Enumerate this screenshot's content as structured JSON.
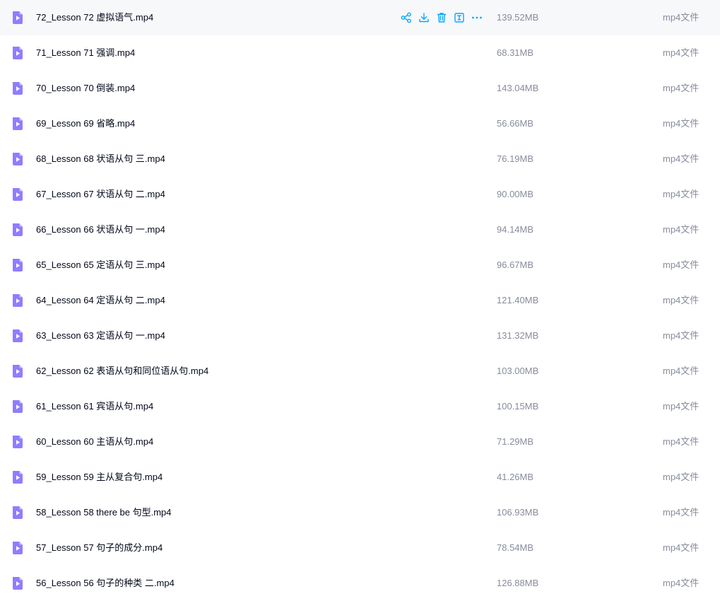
{
  "colors": {
    "accent": "#06a7ff",
    "icon_purple": "#8f7dff",
    "hover_row_bg": "#f7f8fa",
    "name_text": "#03081a",
    "meta_text": "#878c9c"
  },
  "row_actions": [
    {
      "name": "share-icon"
    },
    {
      "name": "download-icon"
    },
    {
      "name": "delete-icon"
    },
    {
      "name": "rename-icon"
    },
    {
      "name": "more-icon"
    }
  ],
  "files": [
    {
      "name": "72_Lesson 72 虚拟语气.mp4",
      "size": "139.52MB",
      "type": "mp4文件",
      "icon": "video-file-icon",
      "hovered": true
    },
    {
      "name": "71_Lesson 71 强调.mp4",
      "size": "68.31MB",
      "type": "mp4文件",
      "icon": "video-file-icon"
    },
    {
      "name": "70_Lesson 70 倒装.mp4",
      "size": "143.04MB",
      "type": "mp4文件",
      "icon": "video-file-icon"
    },
    {
      "name": "69_Lesson 69 省略.mp4",
      "size": "56.66MB",
      "type": "mp4文件",
      "icon": "video-file-icon"
    },
    {
      "name": "68_Lesson 68 状语从句 三.mp4",
      "size": "76.19MB",
      "type": "mp4文件",
      "icon": "video-file-icon"
    },
    {
      "name": "67_Lesson 67 状语从句 二.mp4",
      "size": "90.00MB",
      "type": "mp4文件",
      "icon": "video-file-icon"
    },
    {
      "name": "66_Lesson 66 状语从句 一.mp4",
      "size": "94.14MB",
      "type": "mp4文件",
      "icon": "video-file-icon"
    },
    {
      "name": "65_Lesson 65 定语从句 三.mp4",
      "size": "96.67MB",
      "type": "mp4文件",
      "icon": "video-file-icon"
    },
    {
      "name": "64_Lesson 64 定语从句 二.mp4",
      "size": "121.40MB",
      "type": "mp4文件",
      "icon": "video-file-icon"
    },
    {
      "name": "63_Lesson 63 定语从句 一.mp4",
      "size": "131.32MB",
      "type": "mp4文件",
      "icon": "video-file-icon"
    },
    {
      "name": "62_Lesson 62 表语从句和同位语从句.mp4",
      "size": "103.00MB",
      "type": "mp4文件",
      "icon": "video-file-icon"
    },
    {
      "name": "61_Lesson 61 宾语从句.mp4",
      "size": "100.15MB",
      "type": "mp4文件",
      "icon": "video-file-icon"
    },
    {
      "name": "60_Lesson 60 主语从句.mp4",
      "size": "71.29MB",
      "type": "mp4文件",
      "icon": "video-file-icon"
    },
    {
      "name": "59_Lesson 59 主从复合句.mp4",
      "size": "41.26MB",
      "type": "mp4文件",
      "icon": "video-file-icon"
    },
    {
      "name": "58_Lesson 58 there be 句型.mp4",
      "size": "106.93MB",
      "type": "mp4文件",
      "icon": "video-file-icon"
    },
    {
      "name": "57_Lesson 57 句子的成分.mp4",
      "size": "78.54MB",
      "type": "mp4文件",
      "icon": "video-file-icon"
    },
    {
      "name": "56_Lesson 56 句子的种类 二.mp4",
      "size": "126.88MB",
      "type": "mp4文件",
      "icon": "video-file-icon"
    }
  ]
}
